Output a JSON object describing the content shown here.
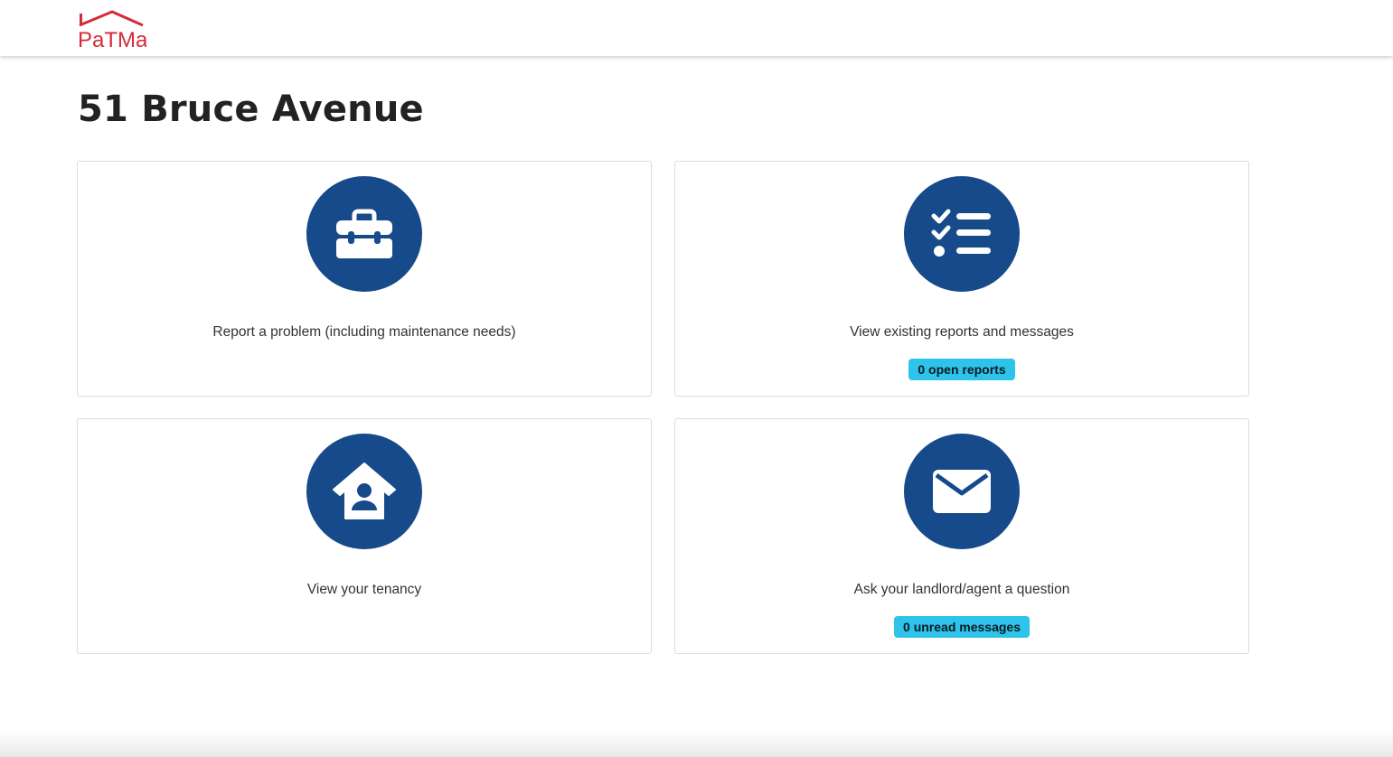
{
  "brand": {
    "logo_text": "PaTMa",
    "logo_color": "#d62a3a"
  },
  "page": {
    "title": "51 Bruce Avenue"
  },
  "colors": {
    "icon_circle": "#164a8a",
    "badge": "#2ec3ea"
  },
  "cards": [
    {
      "id": "report-problem",
      "icon": "toolbox-icon",
      "label": "Report a problem (including maintenance needs)"
    },
    {
      "id": "view-reports",
      "icon": "checklist-icon",
      "label": "View existing reports and messages",
      "badge": "0 open reports"
    },
    {
      "id": "view-tenancy",
      "icon": "house-user-icon",
      "label": "View your tenancy"
    },
    {
      "id": "ask-question",
      "icon": "envelope-icon",
      "label": "Ask your landlord/agent a question",
      "badge": "0 unread messages"
    }
  ]
}
